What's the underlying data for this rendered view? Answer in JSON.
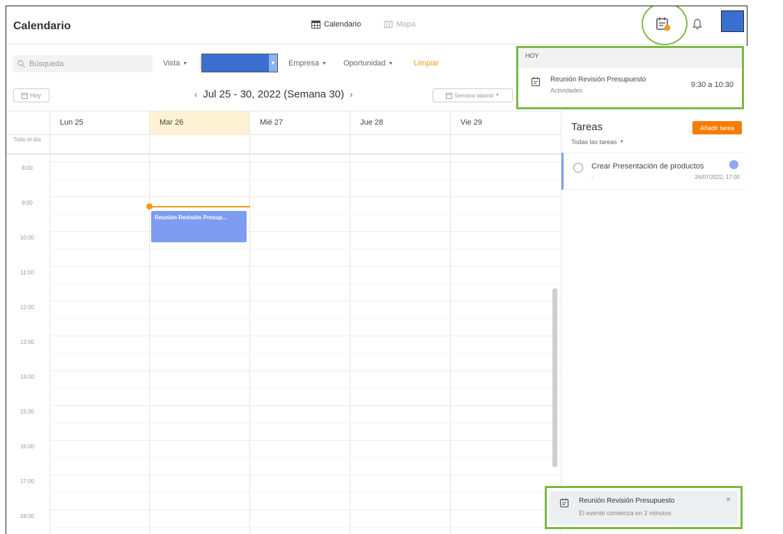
{
  "app": {
    "title": "Calendario"
  },
  "view_tabs": [
    {
      "label": "Calendario",
      "icon": "calendar-grid-icon",
      "active": true
    },
    {
      "label": "Mapa",
      "icon": "map-icon",
      "active": false
    }
  ],
  "filters": {
    "search_placeholder": "Búsqueda",
    "vista": "Vista",
    "empresa": "Empresa",
    "oportunidad": "Oportunidad",
    "limpiar": "Limpiar"
  },
  "nav": {
    "hoy": "Hoy",
    "week": "Jul 25 - 30, 2022 (Semana 30)",
    "prev": "‹",
    "next": "›",
    "view_mode": "Semana laboral"
  },
  "days": [
    "Lun 25",
    "Mar 26",
    "Mié 27",
    "Jue 28",
    "Vie 29"
  ],
  "allday_label": "Todo el día",
  "hours": [
    "8:00",
    "9:00",
    "10:00",
    "11:00",
    "12:00",
    "13:00",
    "14:00",
    "15:00",
    "16:00",
    "17:00",
    "18:00"
  ],
  "event": {
    "title": "Reunión Revisión Presup..."
  },
  "tasks_panel": {
    "title": "Tareas",
    "filter": "Todas las tareas",
    "add_button": "Añadir tarea",
    "items": [
      {
        "title": "Crear Presentación de productos",
        "dash": "-",
        "due": "26/07/2022, 17:00"
      }
    ]
  },
  "hoy_popup": {
    "header": "HOY",
    "item_title": "Reunión Revisión Presupuesto",
    "item_sub": "Actividades",
    "item_time": "9:30 a 10:30"
  },
  "toast": {
    "title": "Reunión Revisión Presupuesto",
    "message": "El evento comienza en 2 minutos",
    "close": "×"
  },
  "colors": {
    "accent_orange": "#f39c12",
    "event_blue": "#7f9cf2",
    "highlight_green": "#7ab845",
    "today_bg": "#fdf3d4"
  }
}
